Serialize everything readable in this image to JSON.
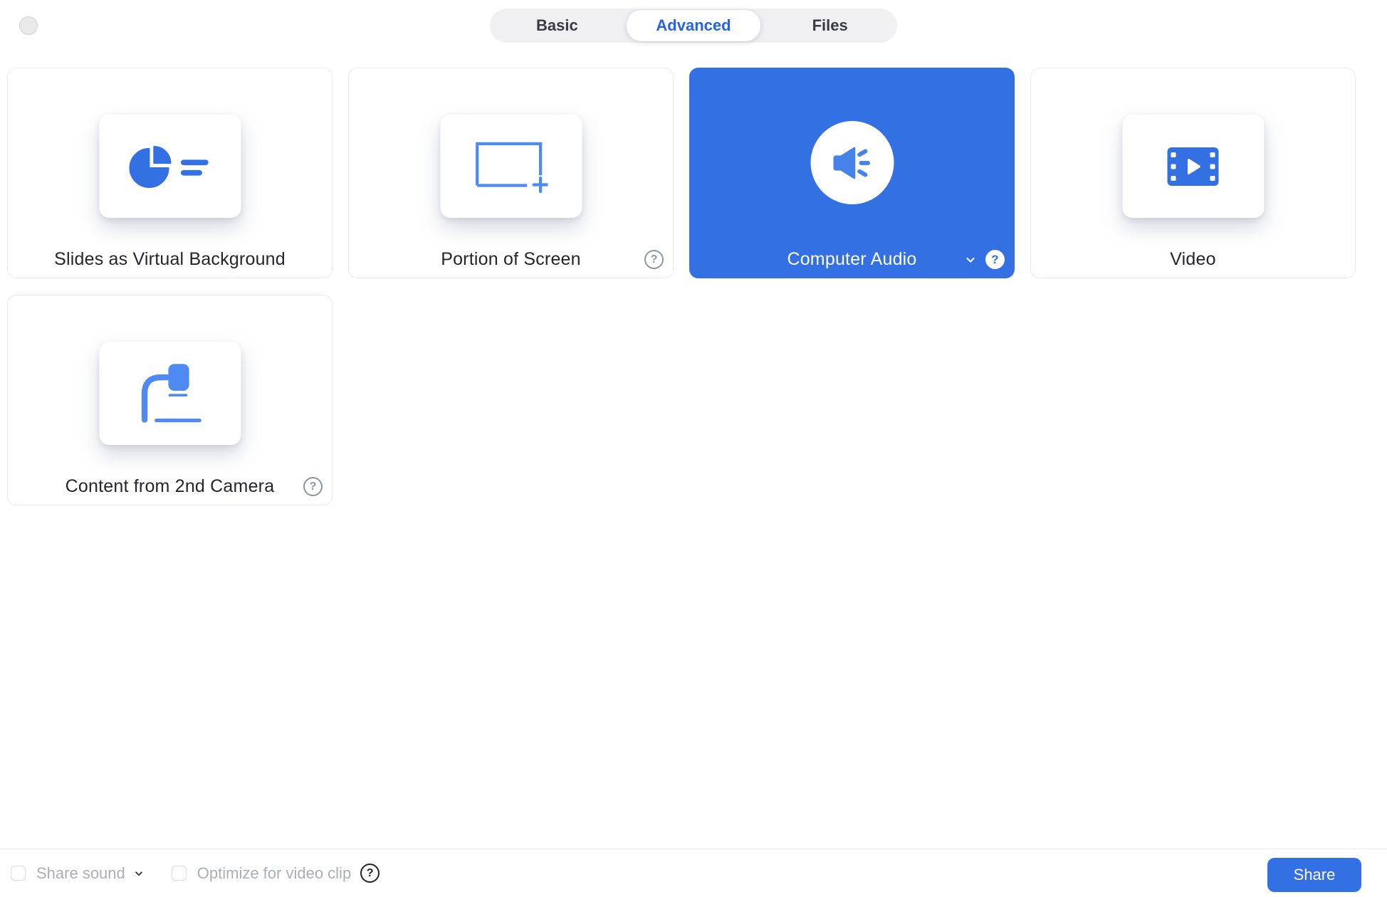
{
  "tabs": {
    "items": [
      {
        "label": "Basic",
        "active": false
      },
      {
        "label": "Advanced",
        "active": true
      },
      {
        "label": "Files",
        "active": false
      }
    ]
  },
  "cards": [
    {
      "label": "Slides as Virtual Background",
      "icon": "pie-chart-slides-icon",
      "selected": false,
      "has_help": false
    },
    {
      "label": "Portion of Screen",
      "icon": "screen-region-add-icon",
      "selected": false,
      "has_help": true
    },
    {
      "label": "Computer Audio",
      "icon": "speaker-sound-icon",
      "selected": true,
      "has_help": true,
      "has_dropdown": true
    },
    {
      "label": "Video",
      "icon": "film-strip-icon",
      "selected": false,
      "has_help": false
    },
    {
      "label": "Content from 2nd Camera",
      "icon": "document-camera-icon",
      "selected": false,
      "has_help": true
    }
  ],
  "help_glyph": "?",
  "footer": {
    "checkboxes": [
      {
        "label": "Share sound",
        "checked": false,
        "has_dropdown": true
      },
      {
        "label": "Optimize for video clip",
        "checked": false,
        "has_help": true
      }
    ],
    "share_label": "Share"
  },
  "colors": {
    "accent-blue": "#3370E4",
    "icon-blue": "#3370E4",
    "icon-blue-light": "#4E8AF2",
    "speaker-blue": "#4583E8",
    "tab-active-text": "#2463E3",
    "card-border": "#EAEBF1",
    "label-dark": "#25252F",
    "muted-label": "#A9ADBD",
    "checkbox-border": "#D7D9E5",
    "tabbar-bg": "#F0F0F3"
  }
}
